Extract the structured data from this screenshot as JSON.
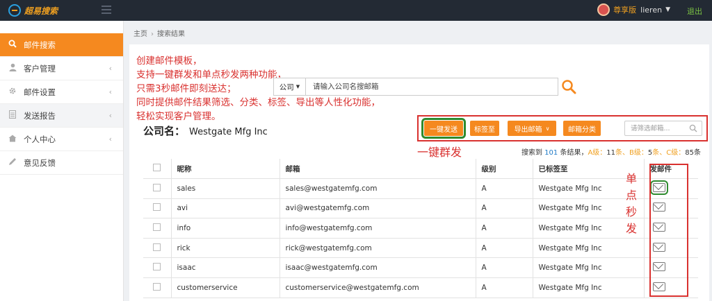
{
  "topbar": {
    "logo_text": "超易搜索",
    "vip_label": "尊享版",
    "username": "lieren",
    "logout": "退出"
  },
  "sidebar": {
    "items": [
      {
        "label": "邮件搜索",
        "icon": "search-icon",
        "active": true
      },
      {
        "label": "客户管理",
        "icon": "user-icon"
      },
      {
        "label": "邮件设置",
        "icon": "gear-icon"
      },
      {
        "label": "发送报告",
        "icon": "document-icon"
      },
      {
        "label": "个人中心",
        "icon": "home-icon"
      },
      {
        "label": "意见反馈",
        "icon": "pencil-icon"
      }
    ]
  },
  "breadcrumb": {
    "home": "主页",
    "current": "搜索结果"
  },
  "annotation": {
    "lines": [
      "创建邮件模板，",
      "支持一键群发和单点秒发两种功能，",
      "只需3秒邮件即刻送达；",
      "同时提供邮件结果筛选、分类、标签、导出等人性化功能，",
      "轻松实现客户管理。"
    ],
    "mass_send": "一键群发",
    "single_send": [
      "单",
      "点",
      "秒",
      "发"
    ]
  },
  "search": {
    "type": "公司",
    "placeholder": "请输入公司名搜邮箱"
  },
  "company": {
    "label": "公司名：",
    "name": "Westgate Mfg Inc"
  },
  "toolbar": {
    "mass_send": "一键发送",
    "tag": "标签至",
    "export": "导出邮箱",
    "classify": "邮箱分类",
    "filter_placeholder": "请筛选邮箱..."
  },
  "summary": {
    "prefix": "搜索到",
    "total": "101",
    "unit": "条结果，",
    "a_label": "A级：",
    "a_count": "11",
    "b_label": "条、B级：",
    "b_count": "5",
    "c_label": "条、C级：",
    "c_count": "85",
    "suffix": "条"
  },
  "table": {
    "headers": {
      "nick": "昵称",
      "email": "邮箱",
      "level": "级别",
      "tagged": "已标签至",
      "send": "发邮件"
    },
    "rows": [
      {
        "nick": "sales",
        "email": "sales@westgatemfg.com",
        "level": "A",
        "tagged": "Westgate Mfg Inc"
      },
      {
        "nick": "avi",
        "email": "avi@westgatemfg.com",
        "level": "A",
        "tagged": "Westgate Mfg Inc"
      },
      {
        "nick": "info",
        "email": "info@westgatemfg.com",
        "level": "A",
        "tagged": "Westgate Mfg Inc"
      },
      {
        "nick": "rick",
        "email": "rick@westgatemfg.com",
        "level": "A",
        "tagged": "Westgate Mfg Inc"
      },
      {
        "nick": "isaac",
        "email": "isaac@westgatemfg.com",
        "level": "A",
        "tagged": "Westgate Mfg Inc"
      },
      {
        "nick": "customerservice",
        "email": "customerservice@westgatemfg.com",
        "level": "A",
        "tagged": "Westgate Mfg Inc"
      }
    ]
  }
}
